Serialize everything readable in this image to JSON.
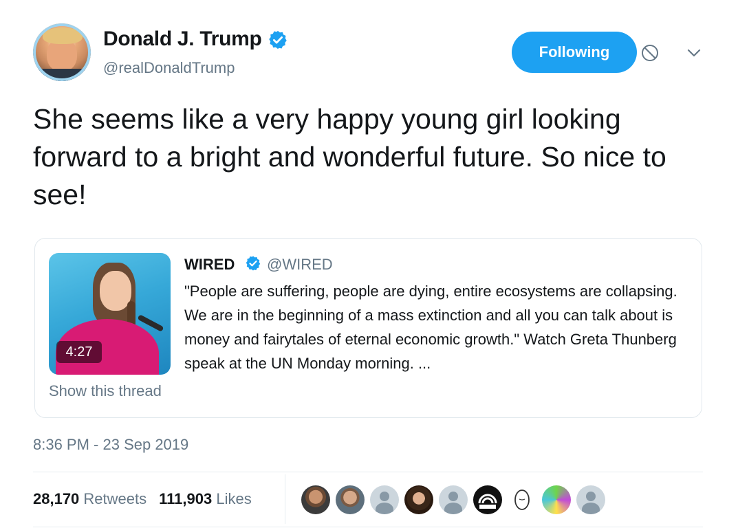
{
  "author": {
    "display_name": "Donald J. Trump",
    "handle": "@realDonaldTrump",
    "verified": true,
    "avatar_icon": "profile-photo"
  },
  "actions": {
    "follow_label": "Following",
    "block_icon": "block-icon",
    "menu_icon": "chevron-down-icon"
  },
  "tweet": {
    "text": "She seems like a very happy young girl looking forward to a bright and wonderful future. So nice to see!",
    "timestamp": "8:36 PM - 23 Sep 2019"
  },
  "quoted_tweet": {
    "name": "WIRED",
    "handle": "@WIRED",
    "verified": true,
    "text": "\"People are suffering, people are dying, entire ecosystems are collapsing. We are in the beginning of a mass extinction and all you can talk about is money and fairytales of eternal economic growth.\" Watch Greta Thunberg speak at the UN Monday morning. ...",
    "video_duration": "4:27",
    "show_thread_label": "Show this thread"
  },
  "stats": {
    "retweets_count": "28,170",
    "retweets_label": "Retweets",
    "likes_count": "111,903",
    "likes_label": "Likes"
  },
  "likers": [
    "photo",
    "photo",
    "default",
    "photo",
    "default",
    "logo",
    "sketch",
    "art",
    "default"
  ],
  "colors": {
    "accent": "#1da1f2",
    "secondary_text": "#657786",
    "border": "#e1e8ed"
  }
}
